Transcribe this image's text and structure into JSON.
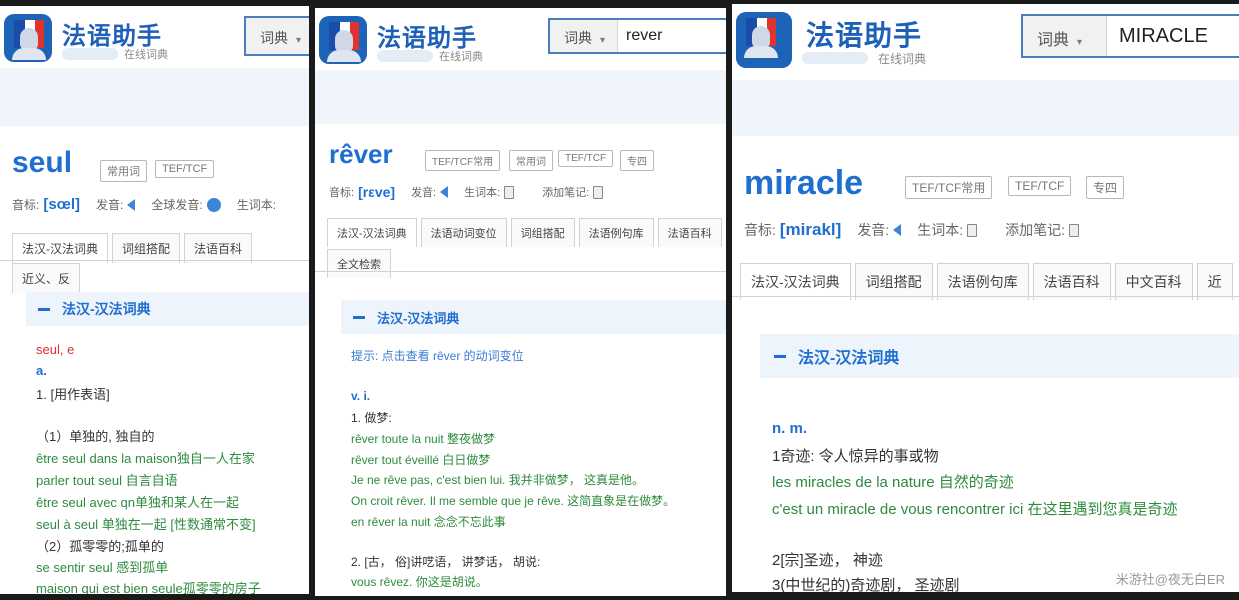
{
  "app": {
    "title": "法语助手",
    "subtitle": "在线词典",
    "search_type": "词典"
  },
  "panel1": {
    "search_value": "",
    "headword": "seul",
    "tags": [
      "常用词",
      "TEF/TCF"
    ],
    "meta": {
      "phonetic_label": "音标:",
      "phonetic": "[sœl]",
      "pronounce_label": "发音:",
      "global_label": "全球发音:",
      "vocab_label": "生词本:"
    },
    "tabs": [
      "法汉-汉法词典",
      "词组搭配",
      "法语百科",
      "近义、反"
    ],
    "section": "法汉-汉法词典",
    "lines": [
      {
        "cls": "red",
        "text": "seul, e"
      },
      {
        "cls": "blue",
        "text": "a."
      },
      {
        "cls": "dark",
        "text": "1. [用作表语]"
      },
      {
        "cls": "dark",
        "text": "（1）单独的, 独自的"
      },
      {
        "cls": "green",
        "text": "être seul dans la maison独自一人在家"
      },
      {
        "cls": "green",
        "text": "parler tout seul 自言自语"
      },
      {
        "cls": "green",
        "text": "être seul avec qn单独和某人在一起"
      },
      {
        "cls": "green",
        "text": "seul à seul 单独在一起 [性数通常不变]"
      },
      {
        "cls": "dark",
        "text": "（2）孤零零的;孤单的"
      },
      {
        "cls": "green",
        "text": "se sentir seul 感到孤单"
      },
      {
        "cls": "green",
        "text": "maison qui est bien seule孤零零的房子"
      }
    ]
  },
  "panel2": {
    "search_value": "rever",
    "headword": "rêver",
    "tags": [
      "TEF/TCF常用",
      "常用词",
      "TEF/TCF",
      "专四"
    ],
    "meta": {
      "phonetic_label": "音标:",
      "phonetic": "[rεve]",
      "pronounce_label": "发音:",
      "vocab_label": "生词本:",
      "notes_label": "添加笔记:"
    },
    "tabs": [
      "法汉-汉法词典",
      "法语动词变位",
      "词组搭配",
      "法语例句库",
      "法语百科",
      "全文检索"
    ],
    "section": "法汉-汉法词典",
    "hint": "提示: 点击查看 rêver 的动词变位",
    "lines": [
      {
        "cls": "blue",
        "text": "v. i."
      },
      {
        "cls": "dark",
        "text": "1. 做梦:"
      },
      {
        "cls": "green",
        "text": "rêver toute la nuit 整夜做梦"
      },
      {
        "cls": "green",
        "text": "rêver tout éveillé 白日做梦"
      },
      {
        "cls": "green",
        "text": "Je ne rêve pas, c'est bien lui. 我并非做梦， 这真是他。"
      },
      {
        "cls": "green",
        "text": "On croit rêver. Il me semble que je rêve. 这简直象是在做梦。"
      },
      {
        "cls": "green",
        "text": "en rêver la nuit 念念不忘此事"
      },
      {
        "cls": "dark",
        "text": "2. [古， 俗]讲呓语， 讲梦话， 胡说:"
      },
      {
        "cls": "green",
        "text": "vous rêvez. 你这是胡说。"
      }
    ]
  },
  "panel3": {
    "search_value": "MIRACLE",
    "headword": "miracle",
    "tags": [
      "TEF/TCF常用",
      "TEF/TCF",
      "专四"
    ],
    "meta": {
      "phonetic_label": "音标:",
      "phonetic": "[mirakl]",
      "pronounce_label": "发音:",
      "vocab_label": "生词本:",
      "notes_label": "添加笔记:"
    },
    "tabs": [
      "法汉-汉法词典",
      "词组搭配",
      "法语例句库",
      "法语百科",
      "中文百科",
      "近"
    ],
    "section": "法汉-汉法词典",
    "lines": [
      {
        "cls": "blue",
        "text": "n. m."
      },
      {
        "cls": "dark",
        "text": "1奇迹: 令人惊异的事或物"
      },
      {
        "cls": "green",
        "text": "les miracles de la nature 自然的奇迹"
      },
      {
        "cls": "green",
        "text": "c'est un miracle de vous rencontrer ici 在这里遇到您真是奇迹"
      },
      {
        "cls": "dark",
        "text": "2[宗]圣迹， 神迹"
      },
      {
        "cls": "dark",
        "text": "3(中世纪的)奇迹剧， 圣迹剧"
      }
    ]
  },
  "watermark": "米游社@夜无白ER"
}
